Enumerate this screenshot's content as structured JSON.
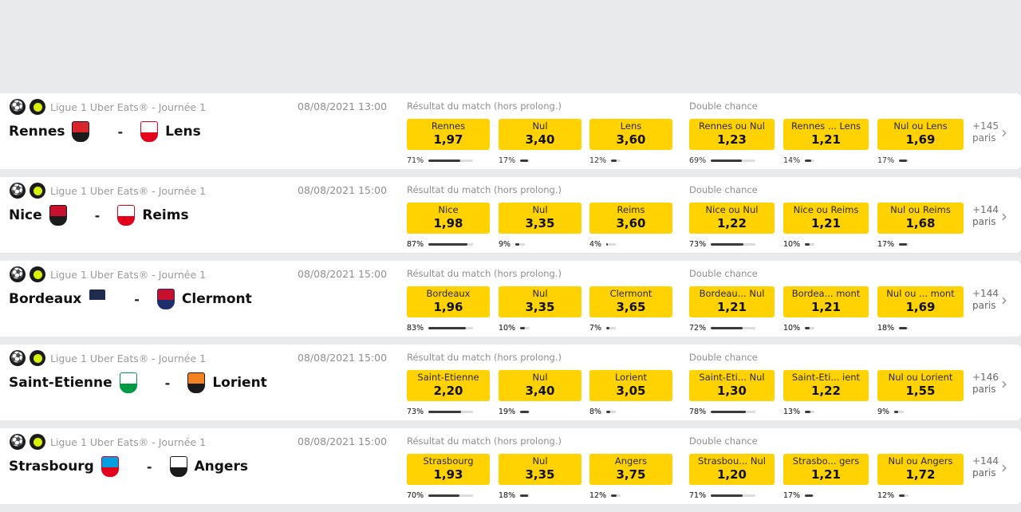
{
  "colors": {
    "odd_button": "#ffd200",
    "background": "#e9eaec",
    "card": "#ffffff"
  },
  "market_labels": {
    "result": "Résultat du match (hors prolong.)",
    "double": "Double chance"
  },
  "matches": [
    {
      "league": "Ligue 1 Uber Eats® - Journée 1",
      "date": "08/08/2021 13:00",
      "home": "Rennes",
      "away": "Lens",
      "home_crest": [
        "#d8262c",
        "#1b1b1b"
      ],
      "away_crest": [
        "#ffffff",
        "#e2001a"
      ],
      "odds": [
        {
          "label": "Rennes",
          "value": "1,97",
          "pct": "71%",
          "fill": 0.71
        },
        {
          "label": "Nul",
          "value": "3,40",
          "pct": "17%",
          "fill": 0.17
        },
        {
          "label": "Lens",
          "value": "3,60",
          "pct": "12%",
          "fill": 0.12
        },
        {
          "label": "Rennes ou Nul",
          "value": "1,23",
          "pct": "69%",
          "fill": 0.69
        },
        {
          "label": "Rennes ... Lens",
          "value": "1,21",
          "pct": "14%",
          "fill": 0.14
        },
        {
          "label": "Nul ou Lens",
          "value": "1,69",
          "pct": "17%",
          "fill": 0.17
        }
      ],
      "more_count": "+145",
      "more_label": "paris"
    },
    {
      "league": "Ligue 1 Uber Eats® - Journée 1",
      "date": "08/08/2021 15:00",
      "home": "Nice",
      "away": "Reims",
      "home_crest": [
        "#c8102e",
        "#1b1b1b"
      ],
      "away_crest": [
        "#ffffff",
        "#e2001a"
      ],
      "odds": [
        {
          "label": "Nice",
          "value": "1,98",
          "pct": "87%",
          "fill": 0.87
        },
        {
          "label": "Nul",
          "value": "3,35",
          "pct": "9%",
          "fill": 0.09
        },
        {
          "label": "Reims",
          "value": "3,60",
          "pct": "4%",
          "fill": 0.04
        },
        {
          "label": "Nice ou Nul",
          "value": "1,22",
          "pct": "73%",
          "fill": 0.73
        },
        {
          "label": "Nice ou Reims",
          "value": "1,21",
          "pct": "10%",
          "fill": 0.1
        },
        {
          "label": "Nul ou Reims",
          "value": "1,68",
          "pct": "17%",
          "fill": 0.17
        }
      ],
      "more_count": "+144",
      "more_label": "paris"
    },
    {
      "league": "Ligue 1 Uber Eats® - Journée 1",
      "date": "08/08/2021 15:00",
      "home": "Bordeaux",
      "away": "Clermont",
      "home_crest": [
        "#1e2d4f",
        "#ffffff"
      ],
      "away_crest": [
        "#c8102e",
        "#1e2d6b"
      ],
      "odds": [
        {
          "label": "Bordeaux",
          "value": "1,96",
          "pct": "83%",
          "fill": 0.83
        },
        {
          "label": "Nul",
          "value": "3,35",
          "pct": "10%",
          "fill": 0.1
        },
        {
          "label": "Clermont",
          "value": "3,65",
          "pct": "7%",
          "fill": 0.07
        },
        {
          "label": "Bordeau... Nul",
          "value": "1,21",
          "pct": "72%",
          "fill": 0.72
        },
        {
          "label": "Bordea... mont",
          "value": "1,21",
          "pct": "10%",
          "fill": 0.1
        },
        {
          "label": "Nul ou ... mont",
          "value": "1,69",
          "pct": "18%",
          "fill": 0.18
        }
      ],
      "more_count": "+144",
      "more_label": "paris"
    },
    {
      "league": "Ligue 1 Uber Eats® - Journée 1",
      "date": "08/08/2021 15:00",
      "home": "Saint-Etienne",
      "away": "Lorient",
      "home_crest": [
        "#ffffff",
        "#009a44"
      ],
      "away_crest": [
        "#f58220",
        "#1b1b1b"
      ],
      "odds": [
        {
          "label": "Saint-Etienne",
          "value": "2,20",
          "pct": "73%",
          "fill": 0.73
        },
        {
          "label": "Nul",
          "value": "3,40",
          "pct": "19%",
          "fill": 0.19
        },
        {
          "label": "Lorient",
          "value": "3,05",
          "pct": "8%",
          "fill": 0.08
        },
        {
          "label": "Saint-Eti... Nul",
          "value": "1,30",
          "pct": "78%",
          "fill": 0.78
        },
        {
          "label": "Saint-Eti... ient",
          "value": "1,22",
          "pct": "13%",
          "fill": 0.13
        },
        {
          "label": "Nul ou Lorient",
          "value": "1,55",
          "pct": "9%",
          "fill": 0.09
        }
      ],
      "more_count": "+146",
      "more_label": "paris"
    },
    {
      "league": "Ligue 1 Uber Eats® - Journée 1",
      "date": "08/08/2021 15:00",
      "home": "Strasbourg",
      "away": "Angers",
      "home_crest": [
        "#00a0e3",
        "#e2001a"
      ],
      "away_crest": [
        "#ffffff",
        "#1b1b1b"
      ],
      "odds": [
        {
          "label": "Strasbourg",
          "value": "1,93",
          "pct": "70%",
          "fill": 0.7
        },
        {
          "label": "Nul",
          "value": "3,35",
          "pct": "18%",
          "fill": 0.18
        },
        {
          "label": "Angers",
          "value": "3,75",
          "pct": "12%",
          "fill": 0.12
        },
        {
          "label": "Strasbou... Nul",
          "value": "1,20",
          "pct": "71%",
          "fill": 0.71
        },
        {
          "label": "Strasbo... gers",
          "value": "1,21",
          "pct": "17%",
          "fill": 0.17
        },
        {
          "label": "Nul ou Angers",
          "value": "1,72",
          "pct": "12%",
          "fill": 0.12
        }
      ],
      "more_count": "+144",
      "more_label": "paris"
    }
  ]
}
